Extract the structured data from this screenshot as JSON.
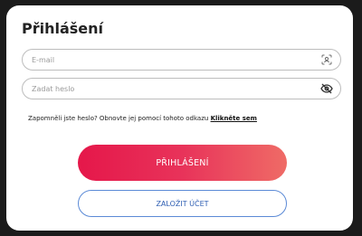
{
  "login": {
    "title": "Přihlášení",
    "email_placeholder": "E-mail",
    "password_placeholder": "Zadat heslo",
    "forgot_text": "Zapomněli jste heslo? Obnovte jej pomocí tohoto odkazu ",
    "forgot_link": "Klikněte sem",
    "submit_label": "PŘIHLÁŠENÍ",
    "register_label": "ZALOŽIT ÚČET"
  },
  "icons": {
    "email_field_icon": "face-scan-icon",
    "password_field_icon": "eye-off-icon"
  },
  "colors": {
    "primary_gradient_start": "#e5174a",
    "primary_gradient_end": "#ef6b66",
    "secondary_border": "#5b8ad6",
    "secondary_text": "#2f5fb3"
  }
}
